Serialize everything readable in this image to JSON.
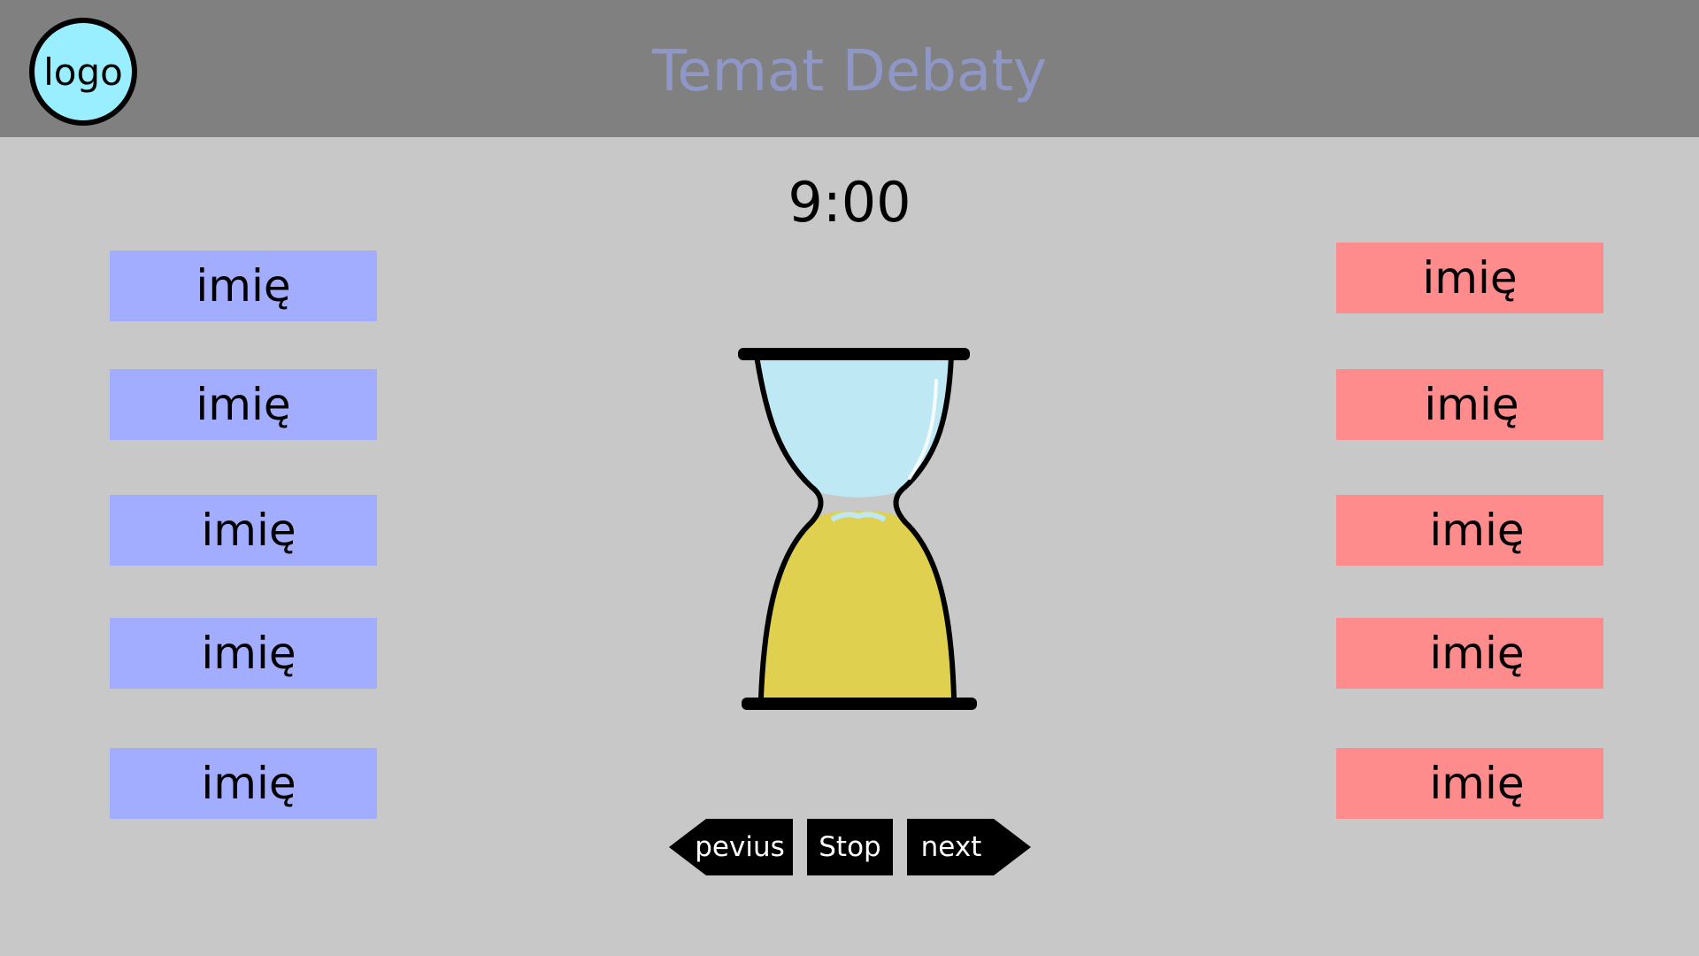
{
  "header": {
    "logo_label": "logo",
    "title": "Temat Debaty",
    "colors": {
      "background": "#808080",
      "title": "#8f97c6",
      "logo_fill": "#99eeff"
    }
  },
  "timer": {
    "value": "9:00"
  },
  "team_a": {
    "color": "#a3adff",
    "names": [
      "imię",
      "imię",
      "imię",
      "imię",
      "imię"
    ]
  },
  "team_b": {
    "color": "#ff8c8c",
    "names": [
      "imię",
      "imię",
      "imię",
      "imię",
      "imię"
    ]
  },
  "hourglass": {
    "icon": "hourglass-icon",
    "colors": {
      "glass": "#bfe8f5",
      "sand": "#e0d050"
    }
  },
  "controls": {
    "previous_label": "pevius",
    "stop_label": "Stop",
    "next_label": "next"
  }
}
